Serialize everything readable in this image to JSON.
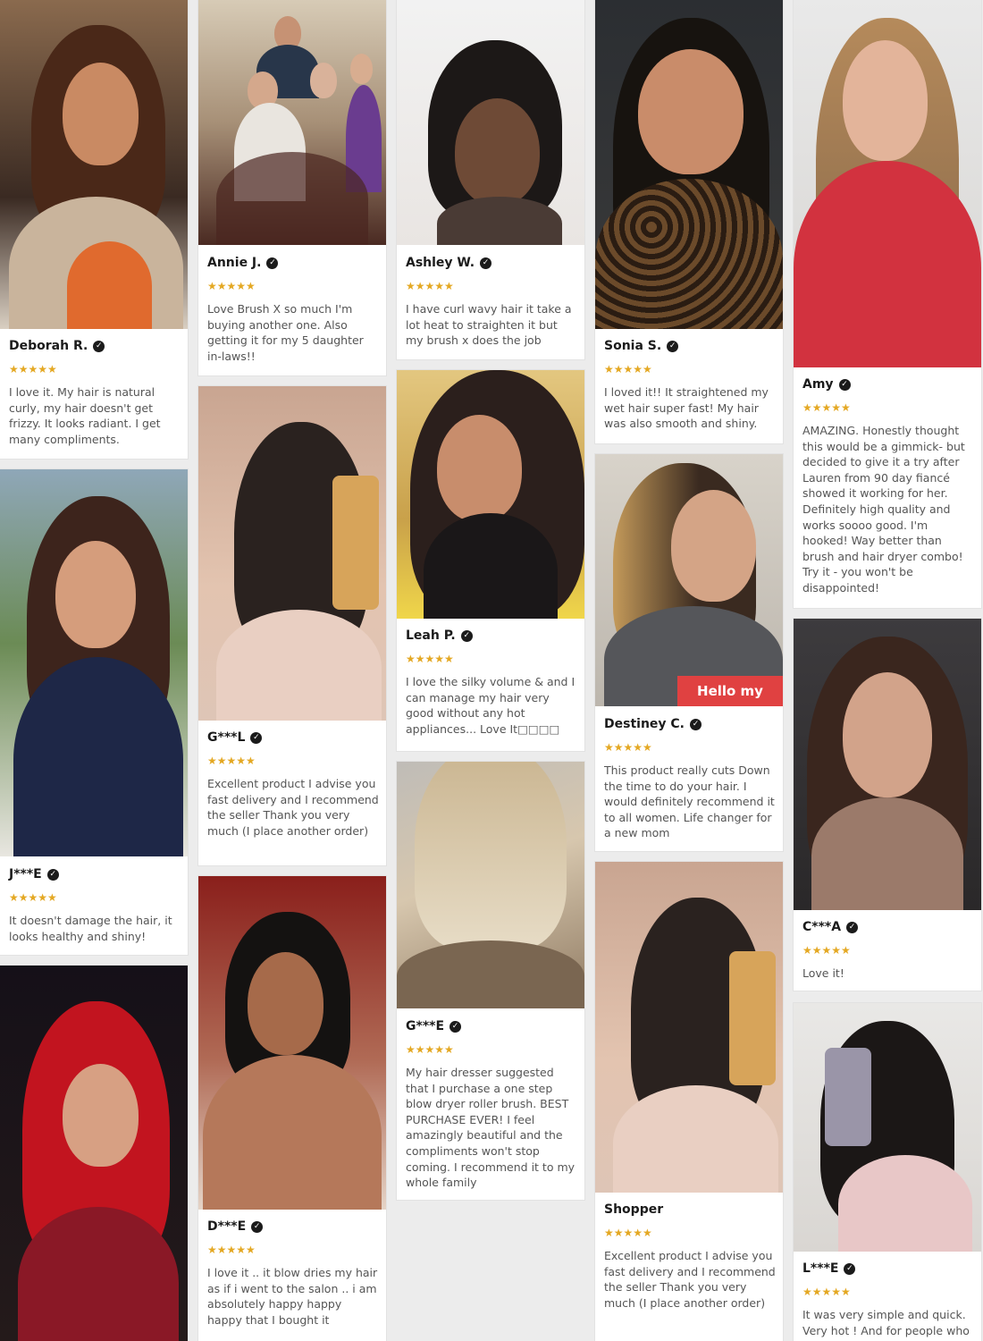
{
  "reviews": [
    {
      "name": "Deborah R.",
      "stars": "★★★★★",
      "text": "I love it. My hair is natural curly, my hair doesn't get frizzy. It looks radiant. I get many compliments."
    },
    {
      "name": "J***E",
      "stars": "★★★★★",
      "text": "It doesn't damage the hair, it looks healthy and shiny!"
    },
    {
      "name": "Annie J.",
      "stars": "★★★★★",
      "text": "Love Brush X so much I'm buying another one. Also getting it for my 5 daughter in-laws!!"
    },
    {
      "name": "G***L",
      "stars": "★★★★★",
      "text": "Excellent product I advise you fast delivery and I recommend the seller Thank you very much (I place another order)"
    },
    {
      "name": "D***E",
      "stars": "★★★★★",
      "text": "I love it .. it blow dries my hair as if i went to the salon .. i am absolutely happy happy happy that I bought it"
    },
    {
      "name": "Ashley W.",
      "stars": "★★★★★",
      "text": "I have curl wavy hair it take a lot heat to straighten it but my brush x does the job"
    },
    {
      "name": "Leah P.",
      "stars": "★★★★★",
      "text": "I love the silky volume & and I can manage my hair very good without any hot appliances... Love It□□□□"
    },
    {
      "name": "G***E",
      "stars": "★★★★★",
      "text": "My hair dresser suggested that I purchase a one step blow dryer roller brush. BEST PURCHASE EVER! I feel amazingly beautiful and the compliments won't stop coming. I recommend it to my whole family"
    },
    {
      "name": "Sonia S.",
      "stars": "★★★★★",
      "text": "I loved it!! It straightened my wet hair super fast! My hair was also smooth and shiny."
    },
    {
      "name": "Destiney C.",
      "stars": "★★★★★",
      "text": "This product really cuts Down the time to do your hair. I would definitely recommend it to all women. Life changer for a new mom"
    },
    {
      "name": "Shopper",
      "stars": "★★★★★",
      "text": "Excellent product I advise you fast delivery and I recommend the seller Thank you very much (I place another order)"
    },
    {
      "name": "Amy",
      "stars": "★★★★★",
      "text": "AMAZING. Honestly thought this would be a gimmick- but decided to give it a try after Lauren from 90 day fiancé showed it working for her. Definitely high quality and works soooo good. I'm hooked! Way better than brush and hair dryer combo! Try it - you won't be disappointed!"
    },
    {
      "name": "C***A",
      "stars": "★★★★★",
      "text": "Love it!"
    },
    {
      "name": "L***E",
      "stars": "★★★★★",
      "text": "It was very simple and quick. Very hot ! And for people who"
    }
  ],
  "photo_scene": {
    "scene_text": "Hello my name is",
    "theme_colors": {
      "star": "#e4a823",
      "name_text": "#1b1b1b",
      "body_text": "#555555"
    }
  }
}
